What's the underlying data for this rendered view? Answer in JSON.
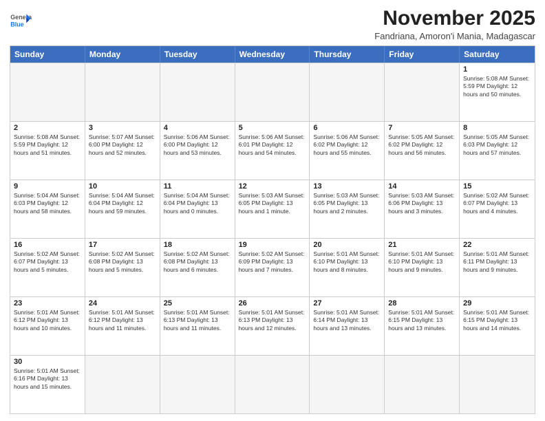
{
  "header": {
    "logo_general": "General",
    "logo_blue": "Blue",
    "month_title": "November 2025",
    "subtitle": "Fandriana, Amoron'i Mania, Madagascar"
  },
  "days_of_week": [
    "Sunday",
    "Monday",
    "Tuesday",
    "Wednesday",
    "Thursday",
    "Friday",
    "Saturday"
  ],
  "weeks": [
    [
      {
        "day": "",
        "info": ""
      },
      {
        "day": "",
        "info": ""
      },
      {
        "day": "",
        "info": ""
      },
      {
        "day": "",
        "info": ""
      },
      {
        "day": "",
        "info": ""
      },
      {
        "day": "",
        "info": ""
      },
      {
        "day": "1",
        "info": "Sunrise: 5:08 AM\nSunset: 5:59 PM\nDaylight: 12 hours\nand 50 minutes."
      }
    ],
    [
      {
        "day": "2",
        "info": "Sunrise: 5:08 AM\nSunset: 5:59 PM\nDaylight: 12 hours\nand 51 minutes."
      },
      {
        "day": "3",
        "info": "Sunrise: 5:07 AM\nSunset: 6:00 PM\nDaylight: 12 hours\nand 52 minutes."
      },
      {
        "day": "4",
        "info": "Sunrise: 5:06 AM\nSunset: 6:00 PM\nDaylight: 12 hours\nand 53 minutes."
      },
      {
        "day": "5",
        "info": "Sunrise: 5:06 AM\nSunset: 6:01 PM\nDaylight: 12 hours\nand 54 minutes."
      },
      {
        "day": "6",
        "info": "Sunrise: 5:06 AM\nSunset: 6:02 PM\nDaylight: 12 hours\nand 55 minutes."
      },
      {
        "day": "7",
        "info": "Sunrise: 5:05 AM\nSunset: 6:02 PM\nDaylight: 12 hours\nand 56 minutes."
      },
      {
        "day": "8",
        "info": "Sunrise: 5:05 AM\nSunset: 6:03 PM\nDaylight: 12 hours\nand 57 minutes."
      }
    ],
    [
      {
        "day": "9",
        "info": "Sunrise: 5:04 AM\nSunset: 6:03 PM\nDaylight: 12 hours\nand 58 minutes."
      },
      {
        "day": "10",
        "info": "Sunrise: 5:04 AM\nSunset: 6:04 PM\nDaylight: 12 hours\nand 59 minutes."
      },
      {
        "day": "11",
        "info": "Sunrise: 5:04 AM\nSunset: 6:04 PM\nDaylight: 13 hours\nand 0 minutes."
      },
      {
        "day": "12",
        "info": "Sunrise: 5:03 AM\nSunset: 6:05 PM\nDaylight: 13 hours\nand 1 minute."
      },
      {
        "day": "13",
        "info": "Sunrise: 5:03 AM\nSunset: 6:05 PM\nDaylight: 13 hours\nand 2 minutes."
      },
      {
        "day": "14",
        "info": "Sunrise: 5:03 AM\nSunset: 6:06 PM\nDaylight: 13 hours\nand 3 minutes."
      },
      {
        "day": "15",
        "info": "Sunrise: 5:02 AM\nSunset: 6:07 PM\nDaylight: 13 hours\nand 4 minutes."
      }
    ],
    [
      {
        "day": "16",
        "info": "Sunrise: 5:02 AM\nSunset: 6:07 PM\nDaylight: 13 hours\nand 5 minutes."
      },
      {
        "day": "17",
        "info": "Sunrise: 5:02 AM\nSunset: 6:08 PM\nDaylight: 13 hours\nand 5 minutes."
      },
      {
        "day": "18",
        "info": "Sunrise: 5:02 AM\nSunset: 6:08 PM\nDaylight: 13 hours\nand 6 minutes."
      },
      {
        "day": "19",
        "info": "Sunrise: 5:02 AM\nSunset: 6:09 PM\nDaylight: 13 hours\nand 7 minutes."
      },
      {
        "day": "20",
        "info": "Sunrise: 5:01 AM\nSunset: 6:10 PM\nDaylight: 13 hours\nand 8 minutes."
      },
      {
        "day": "21",
        "info": "Sunrise: 5:01 AM\nSunset: 6:10 PM\nDaylight: 13 hours\nand 9 minutes."
      },
      {
        "day": "22",
        "info": "Sunrise: 5:01 AM\nSunset: 6:11 PM\nDaylight: 13 hours\nand 9 minutes."
      }
    ],
    [
      {
        "day": "23",
        "info": "Sunrise: 5:01 AM\nSunset: 6:12 PM\nDaylight: 13 hours\nand 10 minutes."
      },
      {
        "day": "24",
        "info": "Sunrise: 5:01 AM\nSunset: 6:12 PM\nDaylight: 13 hours\nand 11 minutes."
      },
      {
        "day": "25",
        "info": "Sunrise: 5:01 AM\nSunset: 6:13 PM\nDaylight: 13 hours\nand 11 minutes."
      },
      {
        "day": "26",
        "info": "Sunrise: 5:01 AM\nSunset: 6:13 PM\nDaylight: 13 hours\nand 12 minutes."
      },
      {
        "day": "27",
        "info": "Sunrise: 5:01 AM\nSunset: 6:14 PM\nDaylight: 13 hours\nand 13 minutes."
      },
      {
        "day": "28",
        "info": "Sunrise: 5:01 AM\nSunset: 6:15 PM\nDaylight: 13 hours\nand 13 minutes."
      },
      {
        "day": "29",
        "info": "Sunrise: 5:01 AM\nSunset: 6:15 PM\nDaylight: 13 hours\nand 14 minutes."
      }
    ],
    [
      {
        "day": "30",
        "info": "Sunrise: 5:01 AM\nSunset: 6:16 PM\nDaylight: 13 hours\nand 15 minutes."
      },
      {
        "day": "",
        "info": ""
      },
      {
        "day": "",
        "info": ""
      },
      {
        "day": "",
        "info": ""
      },
      {
        "day": "",
        "info": ""
      },
      {
        "day": "",
        "info": ""
      },
      {
        "day": "",
        "info": ""
      }
    ]
  ]
}
